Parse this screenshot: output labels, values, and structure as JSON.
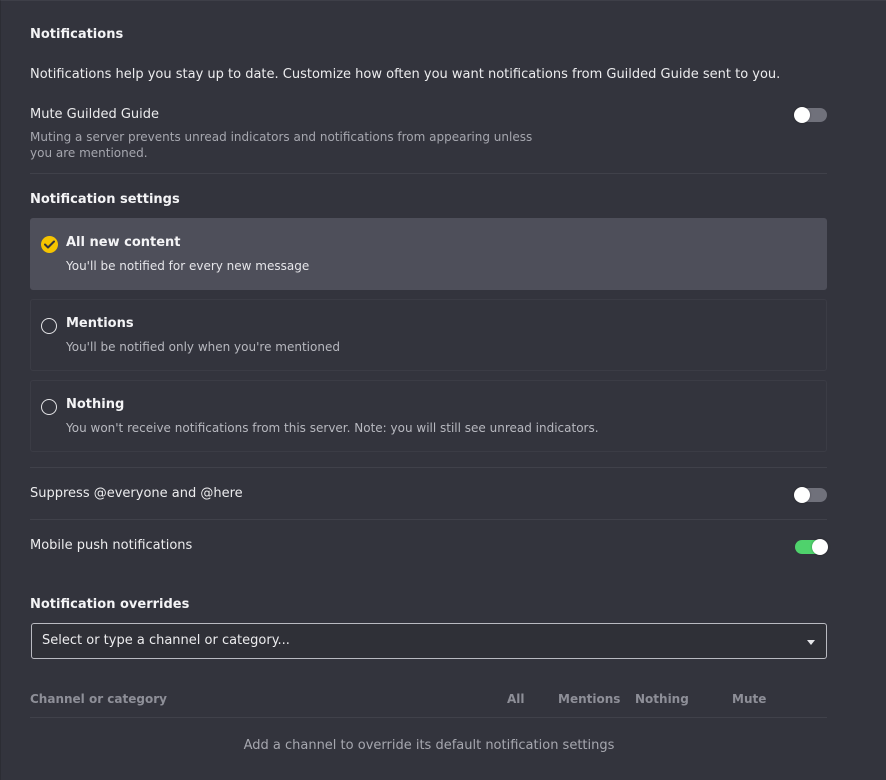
{
  "header": {
    "title": "Notifications",
    "intro": "Notifications help you stay up to date. Customize how often you want notifications from Guilded Guide sent to you."
  },
  "mute": {
    "label": "Mute Guilded Guide",
    "desc_line1": "Muting a server prevents unread indicators and notifications from appearing unless",
    "desc_line2": "you are mentioned.",
    "enabled": false
  },
  "notification_settings": {
    "title": "Notification settings",
    "selected": "all",
    "options": [
      {
        "id": "all",
        "label": "All new content",
        "desc": "You'll be notified for every new message"
      },
      {
        "id": "mentions",
        "label": "Mentions",
        "desc": "You'll be notified only when you're mentioned"
      },
      {
        "id": "nothing",
        "label": "Nothing",
        "desc": "You won't receive notifications from this server. Note: you will still see unread indicators."
      }
    ]
  },
  "suppress": {
    "label": "Suppress @everyone and @here",
    "enabled": false
  },
  "mobile_push": {
    "label": "Mobile push notifications",
    "enabled": true
  },
  "overrides": {
    "title": "Notification overrides",
    "dropdown_text": "Select or type a channel or category...",
    "columns": {
      "channel": "Channel or category",
      "all": "All",
      "mentions": "Mentions",
      "nothing": "Nothing",
      "mute": "Mute"
    },
    "empty_message": "Add a channel to override its default notification settings"
  },
  "colors": {
    "background": "#33343d",
    "selected_card": "#4e4f5a",
    "accent_yellow": "#f5c400",
    "toggle_on": "#4fd26c",
    "toggle_off": "#70717b"
  }
}
